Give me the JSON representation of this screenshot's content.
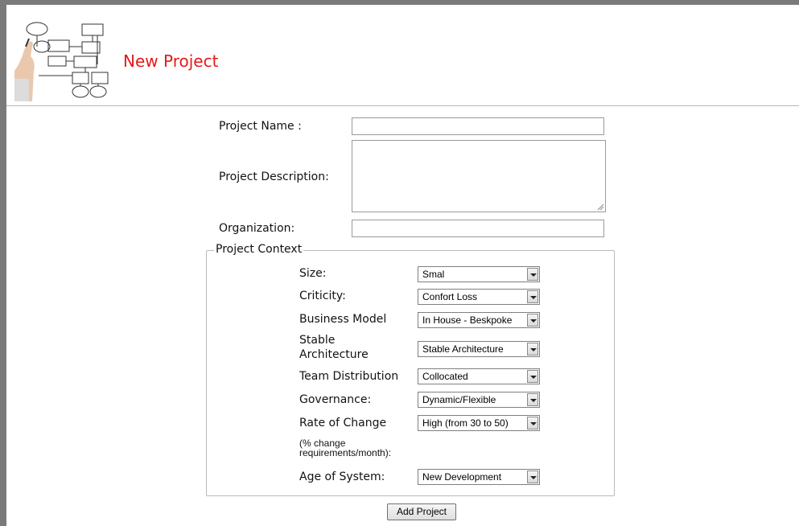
{
  "header": {
    "title": "New Project",
    "logo_icon": "flowchart-hand-drawing-icon"
  },
  "form": {
    "project_name_label": "Project Name :",
    "project_name_value": "",
    "project_description_label": "Project Description:",
    "project_description_value": "",
    "organization_label": "Organization:",
    "organization_value": ""
  },
  "context": {
    "legend": "Project Context",
    "size": {
      "label": "Size:",
      "value": "Smal"
    },
    "criticity": {
      "label": "Criticity:",
      "value": "Confort Loss"
    },
    "business_model": {
      "label": "Business Model",
      "value": "In House - Beskpoke"
    },
    "stable_architecture": {
      "label_line1": "Stable",
      "label_line2": "Architecture",
      "value": "Stable Architecture"
    },
    "team_distribution": {
      "label": "Team Distribution",
      "value": "Collocated"
    },
    "governance": {
      "label": "Governance:",
      "value": "Dynamic/Flexible"
    },
    "rate_of_change": {
      "label": "Rate of Change",
      "note_line1": "(% change",
      "note_line2": "requirements/month):",
      "value": "High (from 30 to 50)"
    },
    "age_of_system": {
      "label": "Age of System:",
      "value": "New Development"
    }
  },
  "actions": {
    "add_project_label": "Add Project"
  }
}
